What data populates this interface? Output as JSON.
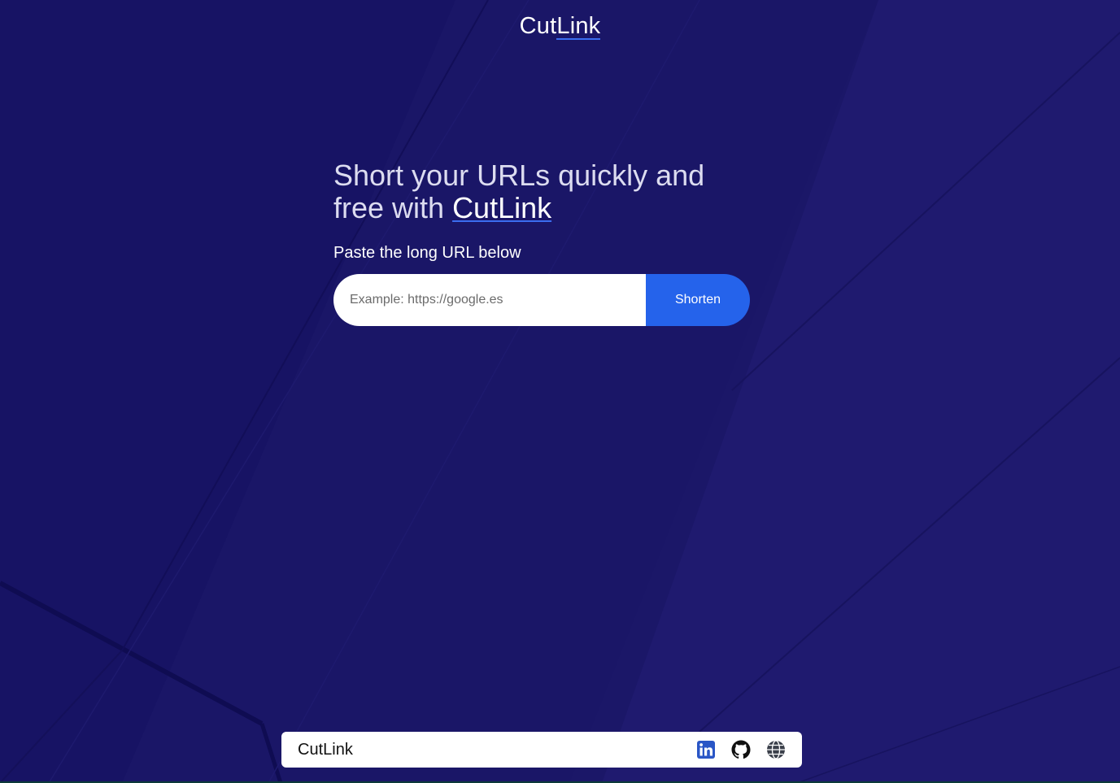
{
  "header": {
    "logo_part1": "Cut",
    "logo_part2": "Link"
  },
  "hero": {
    "title_text": "Short your URLs quickly and free with ",
    "title_brand": "CutLink",
    "subtitle": "Paste the long URL below"
  },
  "form": {
    "placeholder": "Example: https://google.es",
    "value": "",
    "button_label": "Shorten"
  },
  "footer": {
    "brand": "CutLink",
    "icons": [
      "linkedin-icon",
      "github-icon",
      "globe-icon"
    ]
  },
  "colors": {
    "background": "#1b1768",
    "accent": "#2563eb",
    "linkedin": "#2a56c6"
  }
}
